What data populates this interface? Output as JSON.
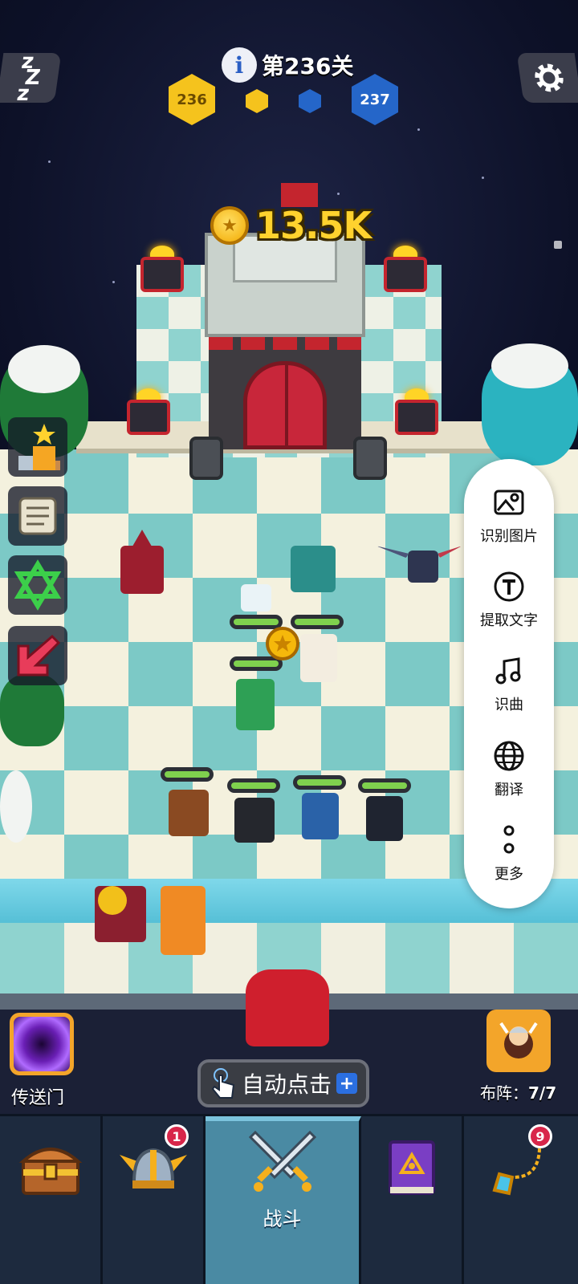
{
  "hud": {
    "level_label": "第236关",
    "current_stage": "236",
    "next_stage": "237"
  },
  "reward": {
    "coin_amount": "13.5K"
  },
  "side_menu": {
    "items": [
      {
        "label": "识别图片",
        "icon": "image-icon"
      },
      {
        "label": "提取文字",
        "icon": "text-t-icon"
      },
      {
        "label": "识曲",
        "icon": "music-note-icon"
      },
      {
        "label": "翻译",
        "icon": "globe-icon"
      },
      {
        "label": "更多",
        "icon": "more-dots-icon"
      }
    ]
  },
  "controls": {
    "portal_label": "传送门",
    "auto_click_label": "自动点击",
    "formation_label": "布阵：",
    "formation_count": "7/7"
  },
  "nav": {
    "tabs": [
      {
        "name": "treasure-chest",
        "label": ""
      },
      {
        "name": "hero-helmet",
        "label": "",
        "badge": "1"
      },
      {
        "name": "battle",
        "label": "战斗"
      },
      {
        "name": "spellbook",
        "label": ""
      },
      {
        "name": "amulet",
        "label": "",
        "badge": "9"
      }
    ]
  },
  "colors": {
    "gold": "#f5c31d",
    "blue": "#2566c9",
    "health": "#7fd14e",
    "active_tab": "#4a8aa3"
  }
}
